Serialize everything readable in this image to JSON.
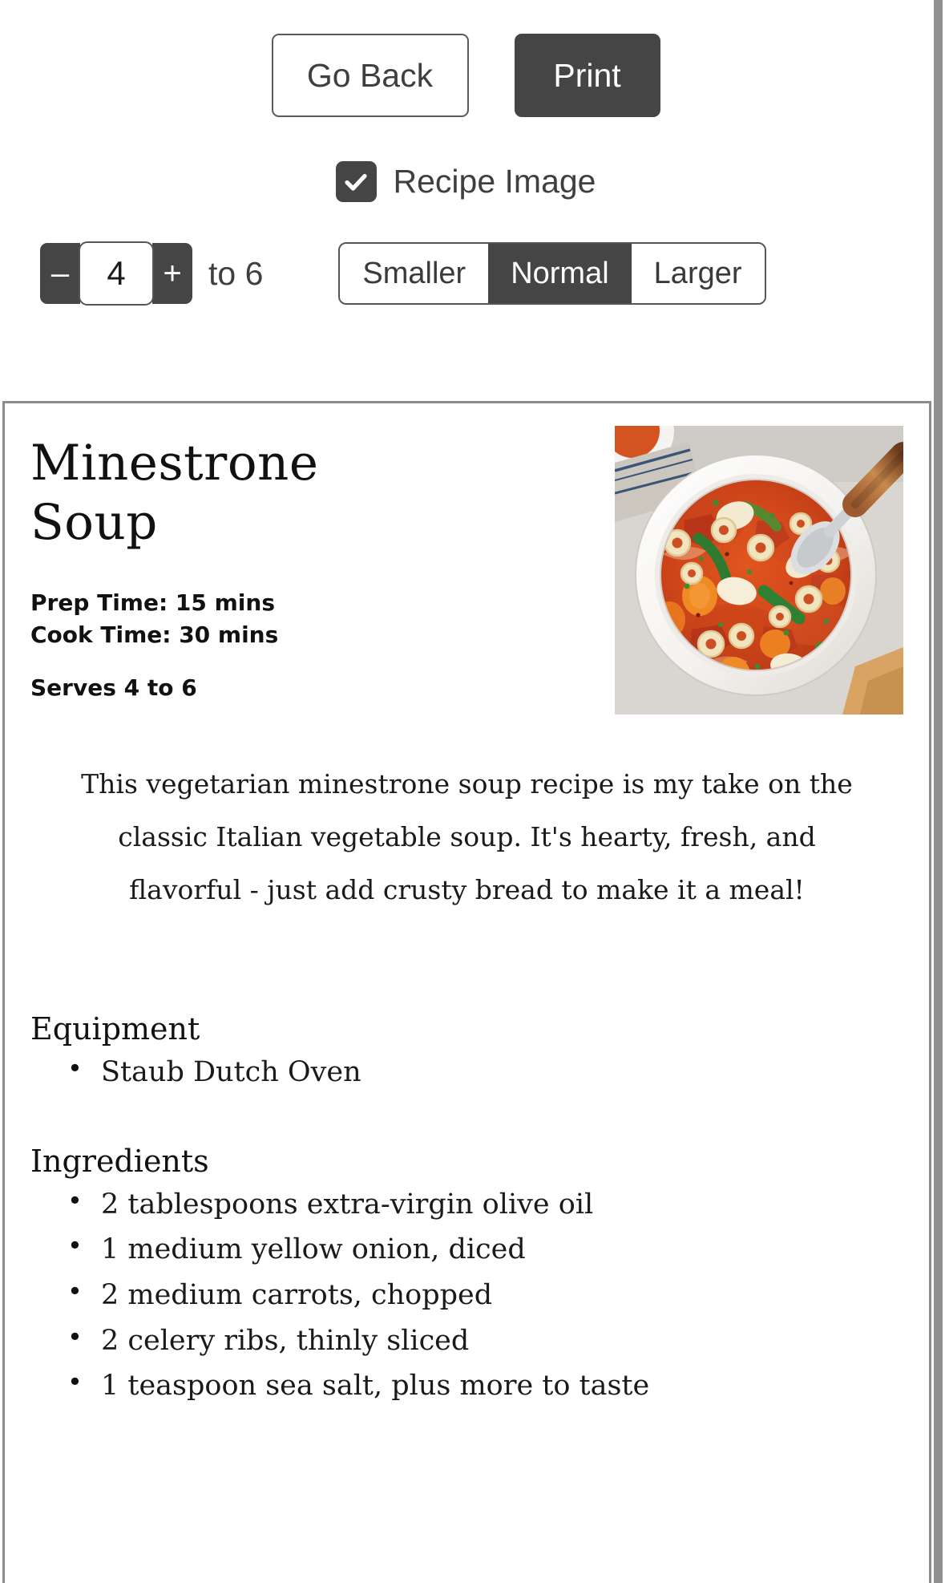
{
  "toolbar": {
    "go_back_label": "Go Back",
    "print_label": "Print",
    "recipe_image_label": "Recipe Image",
    "recipe_image_checked": true,
    "check_icon": "check-icon",
    "servings_value": "4",
    "servings_decrement": "–",
    "servings_increment": "+",
    "servings_range_text": "to 6",
    "size_options": [
      "Smaller",
      "Normal",
      "Larger"
    ],
    "size_selected": "Normal",
    "accent_dark": "#454545",
    "border_gray": "#5a5a5a"
  },
  "recipe": {
    "title": "Minestrone Soup",
    "prep_time": "Prep Time: 15 mins",
    "cook_time": "Cook Time: 30 mins",
    "serves": "Serves 4 to 6",
    "description": "This vegetarian minestrone soup recipe is my take on the classic Italian vegetable soup. It's hearty, fresh, and flavorful - just add crusty bread to make it a meal!",
    "image_alt": "Bowl of minestrone soup with pasta, carrots, green beans and white beans, with a spoon",
    "equipment_heading": "Equipment",
    "equipment": [
      "Staub Dutch Oven"
    ],
    "ingredients_heading": "Ingredients",
    "ingredients": [
      "2 tablespoons extra-virgin olive oil",
      "1 medium yellow onion, diced",
      "2 medium carrots, chopped",
      "2 celery ribs, thinly sliced",
      "1 teaspoon sea salt, plus more to taste"
    ]
  }
}
